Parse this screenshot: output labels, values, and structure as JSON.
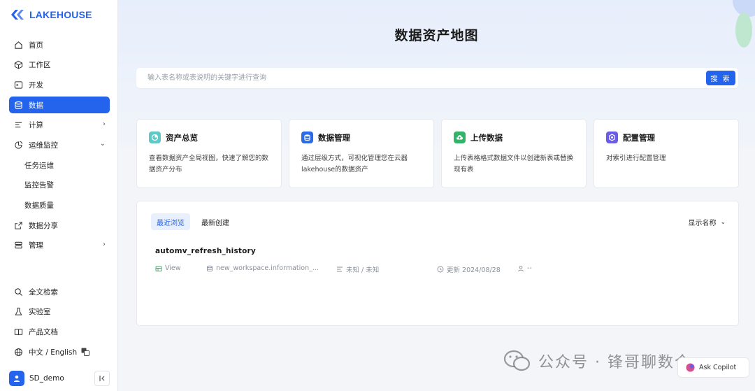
{
  "brand": {
    "name": "LAKEHOUSE",
    "accent": "#2463eb"
  },
  "sidebar": {
    "items": [
      {
        "label": "首页",
        "icon": "home-icon"
      },
      {
        "label": "工作区",
        "icon": "cube-icon"
      },
      {
        "label": "开发",
        "icon": "terminal-icon"
      },
      {
        "label": "数据",
        "icon": "database-icon",
        "active": true
      },
      {
        "label": "计算",
        "icon": "compute-icon",
        "expandable": true
      },
      {
        "label": "运维监控",
        "icon": "monitor-icon",
        "expanded": true
      },
      {
        "label": "任务运维"
      },
      {
        "label": "监控告警"
      },
      {
        "label": "数据质量"
      },
      {
        "label": "数据分享",
        "icon": "share-icon"
      },
      {
        "label": "管理",
        "icon": "manage-icon",
        "expandable": true
      }
    ],
    "bottom_items": [
      {
        "label": "全文检索",
        "icon": "search-icon"
      },
      {
        "label": "实验室",
        "icon": "flask-icon"
      },
      {
        "label": "产品文档",
        "icon": "book-icon"
      },
      {
        "label": "中文 / English",
        "icon": "globe-icon"
      }
    ],
    "user": {
      "name": "SD_demo"
    }
  },
  "main": {
    "title": "数据资产地图",
    "search": {
      "placeholder": "输入表名称或表说明的关键字进行查询",
      "button": "搜 索"
    },
    "cards": [
      {
        "title": "资产总览",
        "desc": "查看数据资产全局视图，快速了解您的数据资产分布",
        "icon": "overview-icon",
        "color": "#5ec9c6"
      },
      {
        "title": "数据管理",
        "desc": "通过层级方式，可视化管理您在云器lakehouse的数据资产",
        "icon": "database-icon",
        "color": "#2d6ae8"
      },
      {
        "title": "上传数据",
        "desc": "上传表格格式数据文件以创建新表或替换现有表",
        "icon": "upload-icon",
        "color": "#34b46a"
      },
      {
        "title": "配置管理",
        "desc": "对索引进行配置管理",
        "icon": "settings-icon",
        "color": "#6a5ce6"
      }
    ],
    "tabs": [
      "最近浏览",
      "最新创建"
    ],
    "sort_label": "显示名称",
    "recent": {
      "name": "automv_refresh_history",
      "type": "View",
      "location": "new_workspace.information_...",
      "owner_info": "未知 / 未知",
      "updated": "更新 2024/08/28",
      "user": "--"
    }
  },
  "watermark": {
    "text": "公众号 · 锋哥聊数仓"
  },
  "copilot": {
    "label": "Ask Copilot"
  }
}
